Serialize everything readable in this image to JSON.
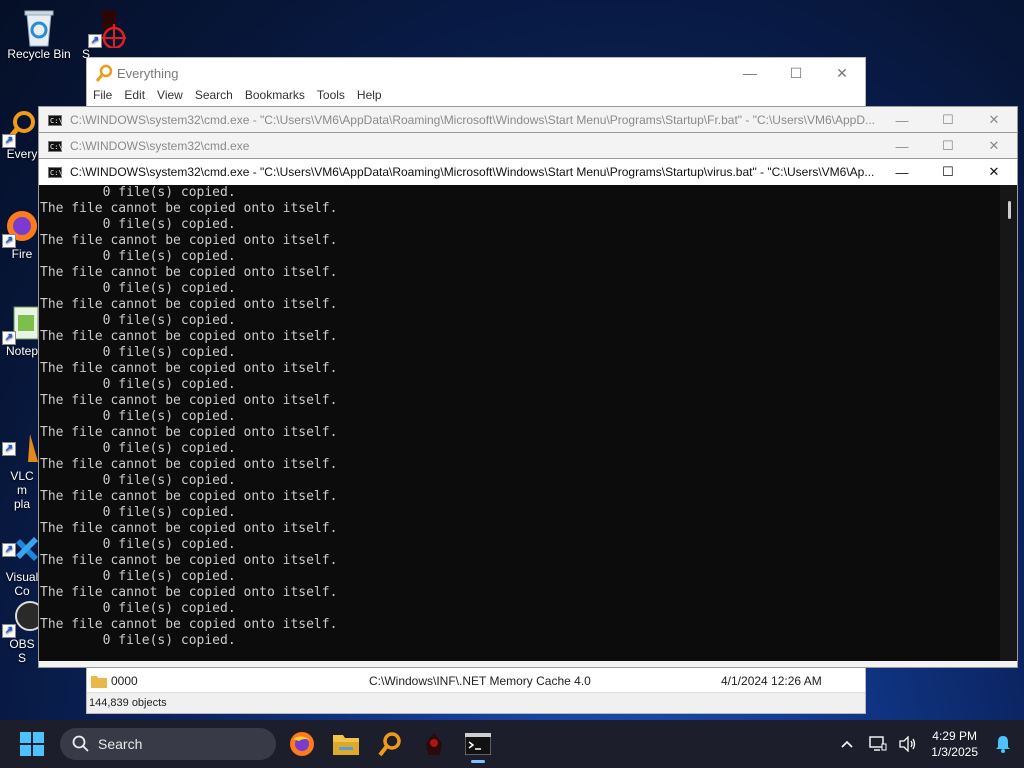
{
  "desktop": {
    "icons": [
      {
        "label": "Recycle Bin",
        "icon": "recycle-bin-icon"
      },
      {
        "label": "S",
        "icon": "crosshair-shortcut-icon"
      },
      {
        "label": "Every",
        "icon": "everything-shortcut-icon"
      },
      {
        "label": "Fire",
        "icon": "firefox-shortcut-icon"
      },
      {
        "label": "Notep",
        "icon": "notepad-shortcut-icon"
      },
      {
        "label": "VLC m\npla",
        "icon": "vlc-shortcut-icon"
      },
      {
        "label": "Visual\nCo",
        "icon": "vscode-shortcut-icon"
      },
      {
        "label": "OBS S",
        "icon": "obs-shortcut-icon"
      }
    ]
  },
  "everything_window": {
    "title": "Everything",
    "menu": [
      "File",
      "Edit",
      "View",
      "Search",
      "Bookmarks",
      "Tools",
      "Help"
    ],
    "row": {
      "name": "0000",
      "path": "C:\\Windows\\INF\\.NET Memory Cache 4.0",
      "date": "4/1/2024 12:26 AM"
    },
    "status": "144,839 objects"
  },
  "cmd_windows": [
    {
      "title": "C:\\WINDOWS\\system32\\cmd.exe - \"C:\\Users\\VM6\\AppData\\Roaming\\Microsoft\\Windows\\Start Menu\\Programs\\Startup\\Fr.bat\" - \"C:\\Users\\VM6\\AppD..."
    },
    {
      "title": "C:\\WINDOWS\\system32\\cmd.exe"
    },
    {
      "title": "C:\\WINDOWS\\system32\\cmd.exe - \"C:\\Users\\VM6\\AppData\\Roaming\\Microsoft\\Windows\\Start Menu\\Programs\\Startup\\virus.bat\" - \"C:\\Users\\VM6\\Ap..."
    }
  ],
  "console": {
    "lines": [
      "        0 file(s) copied.",
      "The file cannot be copied onto itself.",
      "        0 file(s) copied.",
      "The file cannot be copied onto itself.",
      "        0 file(s) copied.",
      "The file cannot be copied onto itself.",
      "        0 file(s) copied.",
      "The file cannot be copied onto itself.",
      "        0 file(s) copied.",
      "The file cannot be copied onto itself.",
      "        0 file(s) copied.",
      "The file cannot be copied onto itself.",
      "        0 file(s) copied.",
      "The file cannot be copied onto itself.",
      "        0 file(s) copied.",
      "The file cannot be copied onto itself.",
      "        0 file(s) copied.",
      "The file cannot be copied onto itself.",
      "        0 file(s) copied.",
      "The file cannot be copied onto itself.",
      "        0 file(s) copied.",
      "The file cannot be copied onto itself.",
      "        0 file(s) copied.",
      "The file cannot be copied onto itself.",
      "        0 file(s) copied.",
      "The file cannot be copied onto itself.",
      "        0 file(s) copied.",
      "The file cannot be copied onto itself.",
      "        0 file(s) copied."
    ]
  },
  "taskbar": {
    "search_label": "Search",
    "apps": [
      "firefox-icon",
      "file-explorer-icon",
      "everything-icon",
      "hacker-tool-icon",
      "cmd-icon"
    ],
    "time": "4:29 PM",
    "date": "1/3/2025"
  }
}
